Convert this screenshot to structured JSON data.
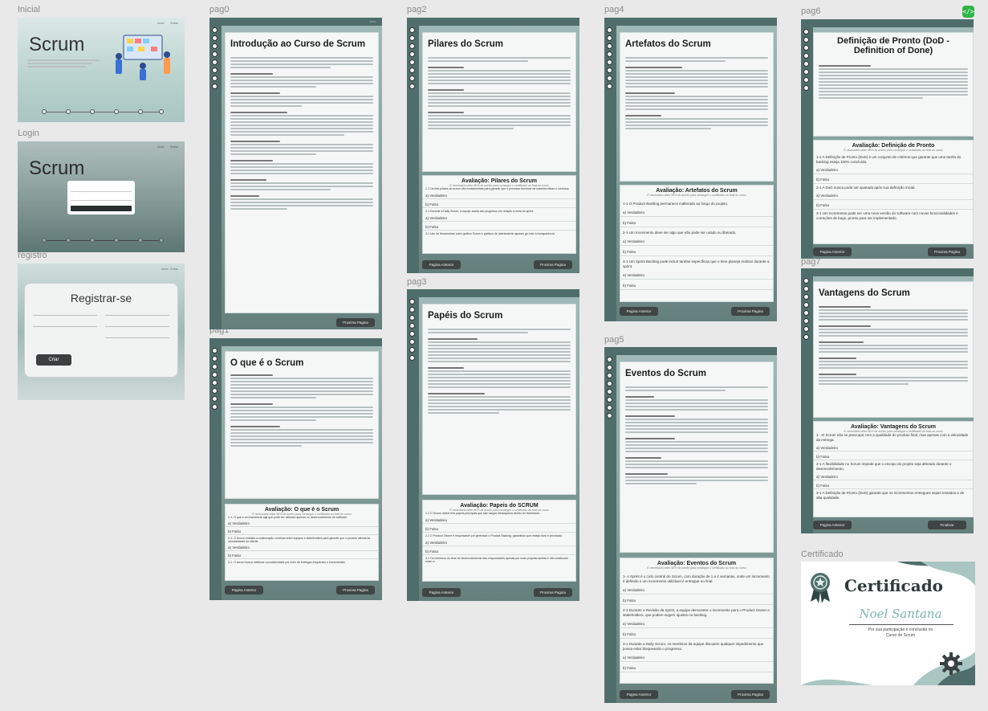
{
  "frame_labels": {
    "inicial": "Inicial",
    "login": "Login",
    "registro": "registro",
    "pag0": "pag0",
    "pag1": "pag1",
    "pag2": "pag2",
    "pag3": "pag3",
    "pag4": "pag4",
    "pag5": "pag5",
    "pag6": "pag6",
    "pag7": "pag7",
    "certificado": "Certificado"
  },
  "hero": {
    "title": "Scrum",
    "nav_home": "Início",
    "nav_entrar": "Entrar"
  },
  "registro": {
    "title": "Registrar-se",
    "submit": "Criar"
  },
  "pages": {
    "pag0": {
      "title": "Introdução ao Curso de Scrum",
      "next": "Proxima Pagina"
    },
    "pag1": {
      "title": "O que é o Scrum",
      "quiz_title": "Avaliação: O que é o Scrum",
      "quiz_sub": "É necessário obter 80% de acerto para conseguir o certificado ao final do curso",
      "q1": "1-1- O que é um framework ágil que pode ser utilizado apenas no desenvolvimento de software",
      "q2": "2-1- O Scrum enfatiza a colaboração contínua entre equipes e stakeholders para garantir que o produto atenda às necessidades do cliente.",
      "q3": "3-1- O scrum busca melhorar a produtividade por meio de entregas frequentes e incrementais.",
      "opt_true": "a) Verdadeiro",
      "opt_false": "b) Falso",
      "prev": "Pagina Anterior",
      "next": "Proxima Pagina"
    },
    "pag2": {
      "title": "Pilares do Scrum",
      "quiz_title": "Avaliação: Pilares do Scrum",
      "quiz_sub": "É necessário obter 80% de acerto para conseguir o certificado ao final do curso",
      "q1": "1-1 Os três pilares do scrum são fundamentais para garantir que o processo funcione de maneira eficaz e contínua.",
      "q2": "2-1 Durante a Daily Scrum, a equipe avalia seu progresso em relação à meta do sprint",
      "q3": "3-1 Uso de ferramentas como gráfico Scrum e gráficos de abertamento ajudam ge ento a transparência.",
      "opt_true": "a) Verdadeiro",
      "opt_false": "b) Falso",
      "prev": "Pagina Anterior",
      "next": "Proxima Pagina"
    },
    "pag3": {
      "title": "Papéis do Scrum",
      "quiz_title": "Avaliação: Papeis do SCRUM",
      "quiz_sub": "É necessário obter 80% de acerto para conseguir o certificado ao final do curso",
      "q1": "1-1 O Scrum define três papéis principais que são cargos hierárquicos dentro do framework.",
      "q2": "2-1 O Product Owner é responsável por gerenciar o Product Backlog, garantindo que esteja claro e priorizado.",
      "q3": "3-1 Os membros do time de desenvolvimento são responsáveis apenas por suas próprias tarefas e não colaboram entre si.",
      "opt_true": "a) Verdadeiro",
      "opt_false": "b) Falso",
      "prev": "Pagina Anterior",
      "next": "Proxima Pagina"
    },
    "pag4": {
      "title": "Artefatos do Scrum",
      "quiz_title": "Avaliação: Artefatos do Scrum",
      "quiz_sub": "É necessário obter 80% de acerto para conseguir o certificado ao final do curso",
      "q1": "1-1 O Product Backlog permanece inalterado ao longo do projeto.",
      "q2": "2-1 Um Incremento deve ser algo que não pode ser usado ou liberado.",
      "q3": "3-1 Um Sprint Backlog pode incluir tarefas específicas que o time planeja realizar durante a sprint.",
      "opt_true": "a) Verdadeiro",
      "opt_false": "b) Falso",
      "prev": "Pagina Anterior",
      "next": "Proxima Pagina"
    },
    "pag5": {
      "title": "Eventos do Scrum",
      "quiz_title": "Avaliação: Eventos do Scrum",
      "quiz_sub": "É necessário obter 80% de acerto para conseguir o certificado ao final do curso",
      "q1": "1- A Sprint é o ciclo central do Scrum, com duração de 1 a 4 semanas, onde um incremento é definido e um incremento utilizável é entregue no final.",
      "q2": "2-1 Durante a Revisão da Sprint, a equipe demonstra o incremento para o Product Owner e stakeholders, que podem sugerir ajustes no backlog.",
      "q3": "3-1 Durante a Daily Scrum, os membros da equipe discutem qualquer impedimento que possa estar bloqueando o progresso.",
      "opt_true": "a) Verdadeiro",
      "opt_false": "b) Falso",
      "prev": "Pagina Anterior",
      "next": "Proxima Pagina"
    },
    "pag6": {
      "title": "Definição de Pronto (DoD - Definition of Done)",
      "quiz_title": "Avaliação:  Definição de Pronto",
      "quiz_sub": "É necessário obter 80% de acerto para conseguir o certificado ao final do curso",
      "q1": "1-1 A Definição de Pronto (DoD) é um conjunto de critérios que garante que uma tarefa do backlog esteja 100% concluída.",
      "q2": "2-1 A DoD nunca pode ser ajustada após sua definição inicial.",
      "q3": "3-1 Um incremento pode ser uma nova versão do software com novas funcionalidades e correções de bugs, pronto para ser implementado.",
      "opt_true": "a) Verdadeiro",
      "opt_false": "b) Falso",
      "prev": "Pagina Anterior",
      "next": "Proxima Pagina"
    },
    "pag7": {
      "title": "Vantagens do Scrum",
      "quiz_title": "Avaliação:  Vantagens do Scrum",
      "quiz_sub": "É necessário obter 80% de acerto para conseguir o certificado ao final do curso",
      "q1": "1- -O Scrum não se preocupa com a qualidade do produto final, mas apenas com a velocidade da entrega.",
      "q2": "2-1 A flexibilidade no Scrum impede que o escopo do projeto seja alterado durante o desenvolvimento.",
      "q3": "3-1 A Definição de Pronto (DoD) garante que os incrementos entregues sejam testados e de alta qualidade.",
      "opt_true": "a) Verdadeiro",
      "opt_false": "b) Falso",
      "prev": "Pagina Anterior",
      "next": "Finalizar"
    }
  },
  "certificado": {
    "title": "Certificado",
    "name": "Noel Santana",
    "text1": "Por sua participação e conclusão no",
    "text2": "Curso de Scrum"
  },
  "colors": {
    "teal": "#4f6e6b",
    "accent_green": "#2fb34a"
  },
  "icons": {
    "code": "code-icon",
    "medal": "medal-icon",
    "gear": "gear-icon"
  }
}
